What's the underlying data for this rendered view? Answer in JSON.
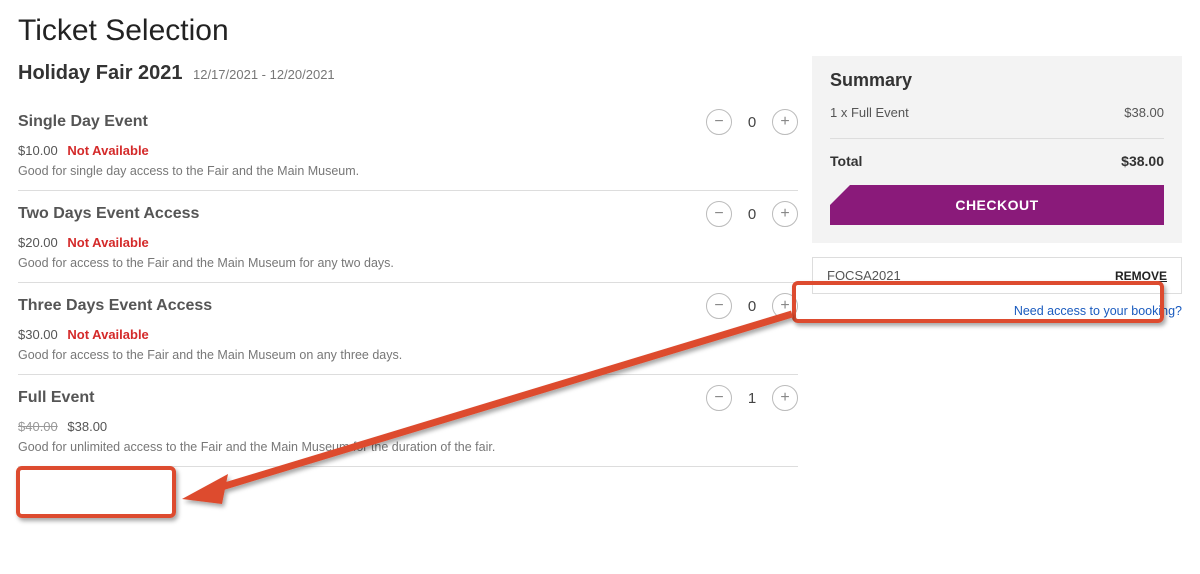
{
  "page_title": "Ticket Selection",
  "event": {
    "title": "Holiday Fair 2021",
    "dates": "12/17/2021 - 12/20/2021"
  },
  "tickets": [
    {
      "name": "Single Day Event",
      "price_display": "$10.00",
      "original_price": "",
      "not_available_label": "Not Available",
      "desc": "Good for single day access to the Fair and the Main Museum.",
      "qty": "0"
    },
    {
      "name": "Two Days Event Access",
      "price_display": "$20.00",
      "original_price": "",
      "not_available_label": "Not Available",
      "desc": "Good for access to the Fair and the Main Museum for any two days.",
      "qty": "0"
    },
    {
      "name": "Three Days Event Access",
      "price_display": "$30.00",
      "original_price": "",
      "not_available_label": "Not Available",
      "desc": "Good for access to the Fair and the Main Museum on any three days.",
      "qty": "0"
    },
    {
      "name": "Full Event",
      "price_display": "$38.00",
      "original_price": "$40.00",
      "not_available_label": "",
      "desc": "Good for unlimited access to the Fair and the Main Museum for the duration of the fair.",
      "qty": "1"
    }
  ],
  "summary": {
    "heading": "Summary",
    "line_item_label": "1 x Full Event",
    "line_item_amount": "$38.00",
    "total_label": "Total",
    "total_amount": "$38.00",
    "checkout_label": "CHECKOUT",
    "promo_code": "FOCSA2021",
    "remove_label": "REMOVE",
    "booking_link": "Need access to your booking?"
  },
  "icons": {
    "minus": "−",
    "plus": "+"
  }
}
